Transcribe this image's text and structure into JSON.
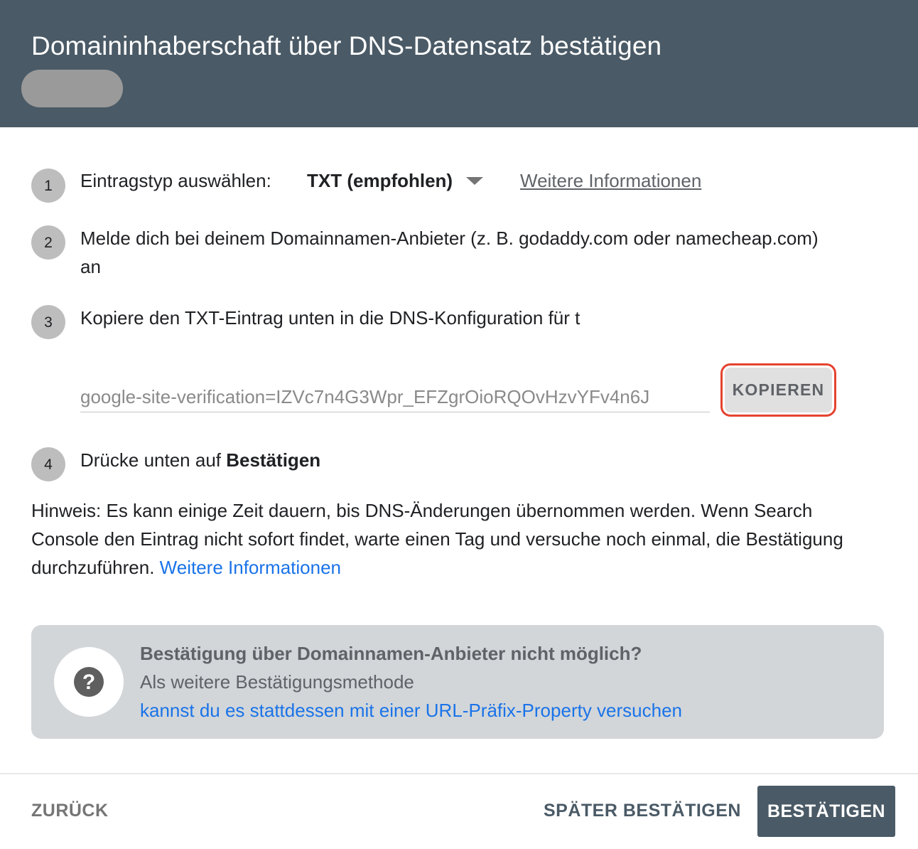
{
  "header": {
    "title": "Domaininhaberschaft über DNS-Datensatz bestätigen"
  },
  "steps": [
    {
      "num": "1",
      "label": "Eintragstyp auswählen:",
      "record_type": "TXT (empfohlen)",
      "more_info": "Weitere Informationen"
    },
    {
      "num": "2",
      "line1": "Melde dich bei deinem Domainnamen-Anbieter (z. B. godaddy.com oder namecheap.com)",
      "line2": "an"
    },
    {
      "num": "3",
      "label": "Kopiere den TXT-Eintrag unten in die DNS-Konfiguration für t"
    },
    {
      "num": "4",
      "prefix": "Drücke unten auf ",
      "bold": "Bestätigen"
    }
  ],
  "txt_record": {
    "value": "google-site-verification=IZVc7n4G3Wpr_EFZgrOioRQOvHzvYFv4n6J",
    "copy_label": "KOPIEREN"
  },
  "note": {
    "text": "Hinweis: Es kann einige Zeit dauern, bis DNS-Änderungen übernommen werden. Wenn Search Console den Eintrag nicht sofort findet, warte einen Tag und versuche noch einmal, die Bestätigung durchzuführen. ",
    "link": "Weitere Informationen"
  },
  "info_box": {
    "icon": "help-icon",
    "title": "Bestätigung über Domainnamen-Anbieter nicht möglich?",
    "text": "Als weitere Bestätigungsmethode",
    "link": "kannst du es stattdessen mit einer URL-Präfix-Property versuchen"
  },
  "footer": {
    "back_label": "ZURÜCK",
    "later_label": "SPÄTER BESTÄTIGEN",
    "verify_label": "BESTÄTIGEN"
  },
  "colors": {
    "header_bg": "#4a5a66",
    "link": "#1a73e8",
    "highlight": "#e5432f",
    "info_box_bg": "#d2d6d9"
  }
}
